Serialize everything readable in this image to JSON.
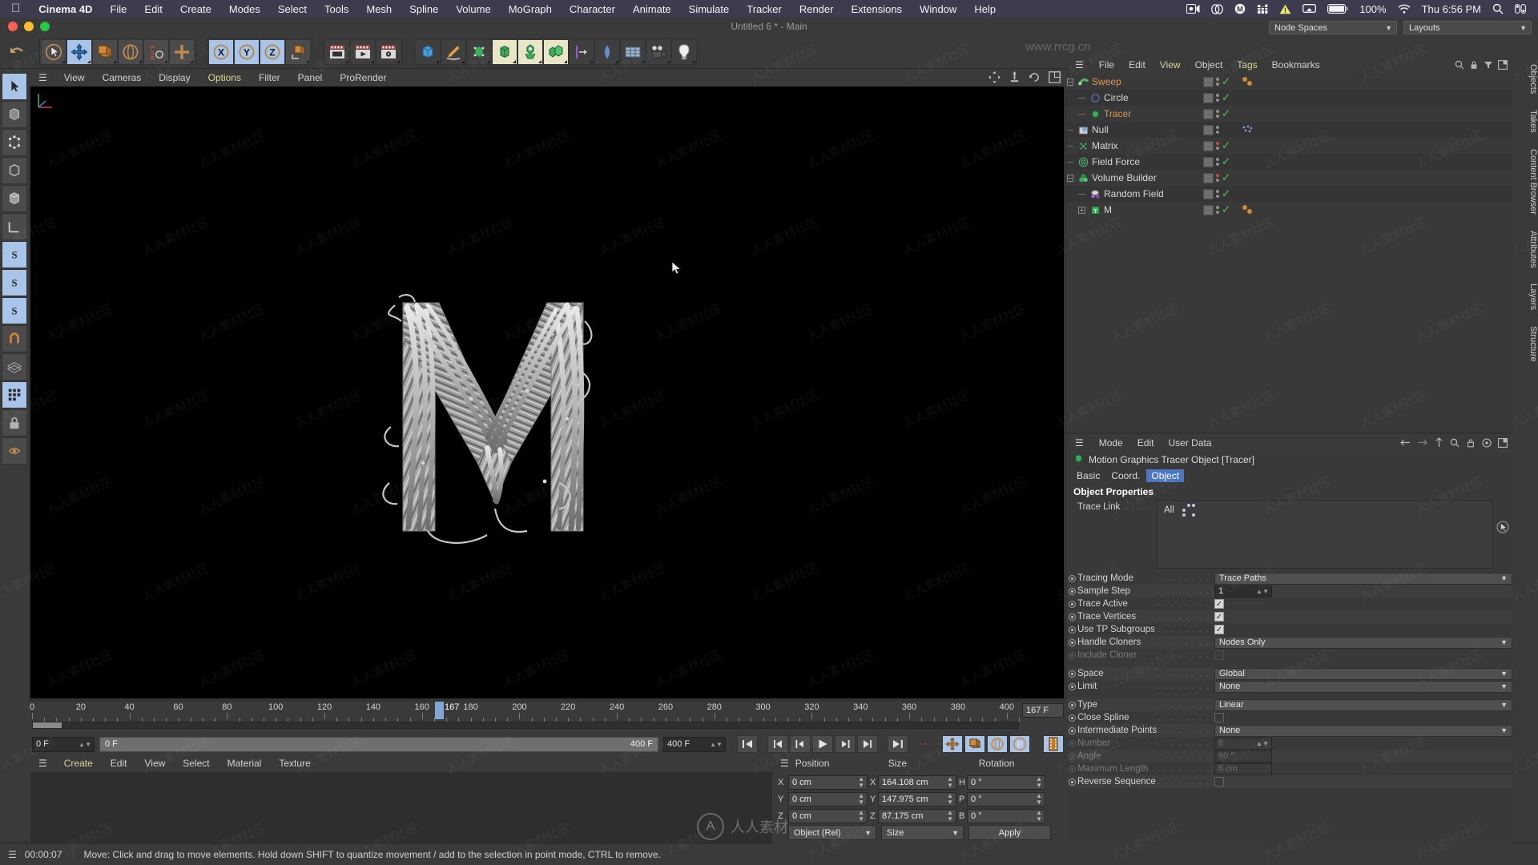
{
  "macbar": {
    "apple_icon": "apple-logo-icon",
    "app_name": "Cinema 4D",
    "menus": [
      "File",
      "Edit",
      "Create",
      "Modes",
      "Select",
      "Tools",
      "Mesh",
      "Spline",
      "Volume",
      "MoGraph",
      "Character",
      "Animate",
      "Simulate",
      "Tracker",
      "Render",
      "Extensions",
      "Window",
      "Help"
    ],
    "right_icons": [
      "screen-record-icon",
      "creative-cloud-icon",
      "mega-icon",
      "equalizer-icon",
      "warning-icon",
      "airplay-icon",
      "battery-icon",
      "wifi-icon",
      "search-icon",
      "control-center-icon"
    ],
    "battery_percent": "100%",
    "clock": "Thu 6:56 PM"
  },
  "titlebar": {
    "document_title": "Untitled 6 * - Main",
    "node_spaces_label": "Node Spaces",
    "layouts_label": "Layouts"
  },
  "watermark": {
    "site": "www.rrcg.cn",
    "brand": "人人素材",
    "tile": "人人素材社区"
  },
  "viewport_menu": {
    "items": [
      "View",
      "Cameras",
      "Display",
      "Options",
      "Filter",
      "Panel",
      "ProRender"
    ],
    "highlighted": "Options",
    "icons": [
      "move-icon",
      "scale-icon",
      "rotate-icon",
      "maximize-view-icon"
    ]
  },
  "main_toolbar": {
    "groups": [
      {
        "name": "undo-redo",
        "buttons": [
          {
            "name": "undo-button",
            "icon": "undo-arrow-icon",
            "active": false
          }
        ]
      },
      {
        "name": "transform-tools",
        "buttons": [
          {
            "name": "select-tool",
            "icon": "cursor-icon",
            "active": false
          },
          {
            "name": "move-tool",
            "icon": "move-cross-icon",
            "active": true
          },
          {
            "name": "scale-tool",
            "icon": "scale-box-icon",
            "active": false
          },
          {
            "name": "rotate-tool",
            "icon": "rotate-circle-icon",
            "active": false
          },
          {
            "name": "psr-tool",
            "icon": "psr-icon",
            "active": false
          },
          {
            "name": "world-local-tool",
            "icon": "plus-axis-icon",
            "active": false
          }
        ]
      },
      {
        "name": "axis-locks",
        "buttons": [
          {
            "name": "lock-x-axis",
            "icon": "x-axis-icon",
            "active": true
          },
          {
            "name": "lock-y-axis",
            "icon": "y-axis-icon",
            "active": true
          },
          {
            "name": "lock-z-axis",
            "icon": "z-axis-icon",
            "active": true
          },
          {
            "name": "world-coordinate-toggle",
            "icon": "world-cube-icon",
            "active": false
          }
        ]
      },
      {
        "name": "render-group",
        "buttons": [
          {
            "name": "render-view-button",
            "icon": "clapper-view-icon",
            "active": false
          },
          {
            "name": "render-to-picture-viewer-button",
            "icon": "clapper-play-icon",
            "active": false
          },
          {
            "name": "render-settings-button",
            "icon": "clapper-gear-icon",
            "active": false
          }
        ]
      },
      {
        "name": "object-group",
        "buttons": [
          {
            "name": "add-cube-button",
            "icon": "cube-icon",
            "active": false
          },
          {
            "name": "add-spline-button",
            "icon": "pen-spline-icon",
            "active": false
          },
          {
            "name": "add-nurbs-button",
            "icon": "green-nurbs-icon",
            "active": false
          },
          {
            "name": "add-array-button",
            "icon": "green-array-icon",
            "active": false,
            "cream": true
          },
          {
            "name": "add-mograph-button",
            "icon": "mograph-cloner-icon",
            "active": false,
            "cream": true
          },
          {
            "name": "add-volume-button",
            "icon": "volume-builder-icon",
            "active": false,
            "cream": true
          },
          {
            "name": "add-deformer-button",
            "icon": "bend-deformer-icon",
            "active": false
          },
          {
            "name": "add-field-button",
            "icon": "field-icon",
            "active": false
          },
          {
            "name": "add-environment-button",
            "icon": "floor-grid-icon",
            "active": false
          },
          {
            "name": "add-camera-button",
            "icon": "camera-icon",
            "active": false
          },
          {
            "name": "add-light-button",
            "icon": "light-bulb-icon",
            "active": false
          }
        ]
      }
    ]
  },
  "left_toolbar": {
    "buttons": [
      {
        "name": "live-selection-tool",
        "icon": "cursor-select-icon",
        "active": true
      },
      {
        "name": "box-model-tool",
        "icon": "box-model-icon",
        "active": false
      },
      {
        "name": "points-mode-tool",
        "icon": "points-mode-icon",
        "active": false
      },
      {
        "name": "edges-mode-tool",
        "icon": "edges-mode-icon",
        "active": false
      },
      {
        "name": "polygons-mode-tool",
        "icon": "polygons-mode-icon",
        "active": false
      },
      {
        "name": "axis-mode-tool",
        "icon": "axis-mode-icon",
        "active": false
      },
      {
        "name": "texture-axis-tool",
        "icon": "texture-axis-icon",
        "active": false
      },
      {
        "name": "enable-axis-tool",
        "icon": "enable-axis-icon",
        "active": false
      },
      {
        "name": "object-axis-tool",
        "icon": "object-axis-icon",
        "active": false
      },
      {
        "name": "viewport-solo-tool",
        "icon": "viewport-solo-icon",
        "active": false
      },
      {
        "name": "workplane-tool",
        "icon": "workplane-icon",
        "active": false
      },
      {
        "name": "snap-tool",
        "icon": "snap-magnet-icon",
        "active": false
      },
      {
        "name": "quantize-tool",
        "icon": "quantize-icon",
        "active": false
      },
      {
        "name": "lock-tool",
        "icon": "lock-icon",
        "active": false
      }
    ]
  },
  "timeline": {
    "ticks": [
      0,
      20,
      40,
      60,
      80,
      100,
      120,
      140,
      160,
      180,
      200,
      220,
      240,
      260,
      280,
      300,
      320,
      340,
      360,
      380,
      400
    ],
    "current_frame_label": "167",
    "current_frame_field": "167 F",
    "start_field": "0 F",
    "range_start": "0 F",
    "range_end": "400 F",
    "end_field": "400 F",
    "min_frame": 0,
    "max_frame": 405
  },
  "transport": {
    "buttons": [
      {
        "name": "go-to-start-button",
        "icon": "skip-start-icon"
      },
      {
        "name": "previous-keyframe-button",
        "icon": "prev-key-icon"
      },
      {
        "name": "step-back-button",
        "icon": "step-back-icon"
      },
      {
        "name": "play-button",
        "icon": "play-icon"
      },
      {
        "name": "step-forward-button",
        "icon": "step-forward-icon"
      },
      {
        "name": "next-keyframe-button",
        "icon": "next-key-icon"
      },
      {
        "name": "go-to-end-button",
        "icon": "skip-end-icon"
      },
      {
        "name": "record-active-objects-button",
        "icon": "record-red-icon"
      },
      {
        "name": "autokeying-button",
        "icon": "autokey-icon"
      },
      {
        "name": "keyframe-settings-button",
        "icon": "keyframe-gear-icon"
      },
      {
        "name": "position-key-button",
        "icon": "position-key-icon"
      },
      {
        "name": "scale-key-button",
        "icon": "scale-key-icon"
      },
      {
        "name": "rotation-key-button",
        "icon": "rotation-key-icon"
      },
      {
        "name": "parameter-key-button",
        "icon": "parameter-key-icon"
      },
      {
        "name": "point-level-animation-button",
        "icon": "pla-icon"
      },
      {
        "name": "timeline-button",
        "icon": "timeline-film-icon"
      }
    ]
  },
  "material_manager": {
    "menus": [
      "Create",
      "Edit",
      "View",
      "Select",
      "Material",
      "Texture"
    ],
    "highlighted": "Create"
  },
  "coordinates": {
    "columns": [
      "Position",
      "Size",
      "Rotation"
    ],
    "position": {
      "x": "0 cm",
      "y": "0 cm",
      "z": "0 cm"
    },
    "size": {
      "x": "164.108 cm",
      "y": "147.975 cm",
      "z": "87.175 cm"
    },
    "rotation": {
      "h": "0 °",
      "p": "0 °",
      "b": "0 °"
    },
    "axis_labels": {
      "p": [
        "X",
        "Y",
        "Z"
      ],
      "s": [
        "X",
        "Y",
        "Z"
      ],
      "r": [
        "H",
        "P",
        "B"
      ]
    },
    "mode_select": "Object (Rel)",
    "size_select": "Size",
    "apply_label": "Apply"
  },
  "object_manager": {
    "menus": [
      "File",
      "Edit",
      "View",
      "Object",
      "Tags",
      "Bookmarks"
    ],
    "highlighted": "View",
    "items": [
      {
        "name": "Sweep",
        "icon": "sweep-icon",
        "depth": 0,
        "expander": "minus",
        "selected": true,
        "color": "orange",
        "dots": "gray",
        "check": true,
        "extra": "orange-tags"
      },
      {
        "name": "Circle",
        "icon": "circle-spline-icon",
        "depth": 1,
        "expander": "none",
        "selected": false,
        "color": "normal",
        "dots": "gray",
        "check": true,
        "extra": "none"
      },
      {
        "name": "Tracer",
        "icon": "tracer-icon",
        "depth": 1,
        "expander": "none",
        "selected": true,
        "color": "orange",
        "dots": "gray",
        "check": true,
        "extra": "none"
      },
      {
        "name": "Null",
        "icon": "null-icon",
        "depth": 0,
        "expander": "none",
        "selected": false,
        "color": "normal",
        "dots": "gray",
        "check": false,
        "extra": "mograph-tag"
      },
      {
        "name": "Matrix",
        "icon": "matrix-icon",
        "depth": 0,
        "expander": "none",
        "selected": false,
        "color": "normal",
        "dots": "red",
        "check": true,
        "extra": "none"
      },
      {
        "name": "Field Force",
        "icon": "field-force-icon",
        "depth": 0,
        "expander": "none",
        "selected": false,
        "color": "normal",
        "dots": "gray",
        "check": true,
        "extra": "none"
      },
      {
        "name": "Volume Builder",
        "icon": "volume-builder-icon",
        "depth": 0,
        "expander": "minus",
        "selected": false,
        "color": "normal",
        "dots": "red",
        "check": true,
        "extra": "none"
      },
      {
        "name": "Random Field",
        "icon": "random-field-icon",
        "depth": 1,
        "expander": "none",
        "selected": false,
        "color": "normal",
        "dots": "gray",
        "check": true,
        "extra": "none"
      },
      {
        "name": "M",
        "icon": "text-object-icon",
        "depth": 1,
        "expander": "plus",
        "selected": false,
        "color": "normal",
        "dots": "gray",
        "check": true,
        "extra": "orange-tags"
      }
    ]
  },
  "attribute_manager": {
    "menus": [
      "Mode",
      "Edit",
      "User Data"
    ],
    "object_title": "Motion Graphics Tracer Object [Tracer]",
    "tabs": [
      {
        "label": "Basic",
        "active": false
      },
      {
        "label": "Coord.",
        "active": false
      },
      {
        "label": "Object",
        "active": true
      }
    ],
    "section_title": "Object Properties",
    "trace_link": {
      "label": "Trace Link",
      "value": "All"
    },
    "properties": [
      {
        "label": "Tracing Mode",
        "type": "select",
        "value": "Trace Paths",
        "enabled": true
      },
      {
        "label": "Sample Step",
        "type": "number",
        "value": "1",
        "enabled": true
      },
      {
        "label": "Trace Active",
        "type": "checkbox",
        "value": true,
        "enabled": true
      },
      {
        "label": "Trace Vertices",
        "type": "checkbox",
        "value": true,
        "enabled": true
      },
      {
        "label": "Use TP Subgroups",
        "type": "checkbox",
        "value": true,
        "enabled": true
      },
      {
        "label": "Handle Cloners",
        "type": "select",
        "value": "Nodes Only",
        "enabled": true
      },
      {
        "label": "Include Cloner",
        "type": "checkbox",
        "value": false,
        "enabled": false
      },
      {
        "label": "Space",
        "type": "select",
        "value": "Global",
        "enabled": true
      },
      {
        "label": "Limit",
        "type": "select",
        "value": "None",
        "enabled": true
      },
      {
        "label": "Type",
        "type": "select",
        "value": "Linear",
        "enabled": true
      },
      {
        "label": "Close Spline",
        "type": "checkbox",
        "value": false,
        "enabled": true
      },
      {
        "label": "Intermediate Points",
        "type": "select",
        "value": "None",
        "enabled": true
      },
      {
        "label": "Number",
        "type": "number",
        "value": "8",
        "enabled": false
      },
      {
        "label": "Angle",
        "type": "text",
        "value": "90 °",
        "enabled": false
      },
      {
        "label": "Maximum Length",
        "type": "text",
        "value": "5 cm",
        "enabled": false
      },
      {
        "label": "Reverse Sequence",
        "type": "checkbox",
        "value": false,
        "enabled": true
      }
    ]
  },
  "right_dock": {
    "items": [
      "Objects",
      "Takes",
      "Content Browser",
      "Attributes",
      "Layers",
      "Structure"
    ]
  },
  "status_bar": {
    "time": "00:00:07",
    "message": "Move: Click and drag to move elements. Hold down SHIFT to quantize movement / add to the selection in point mode, CTRL to remove."
  }
}
